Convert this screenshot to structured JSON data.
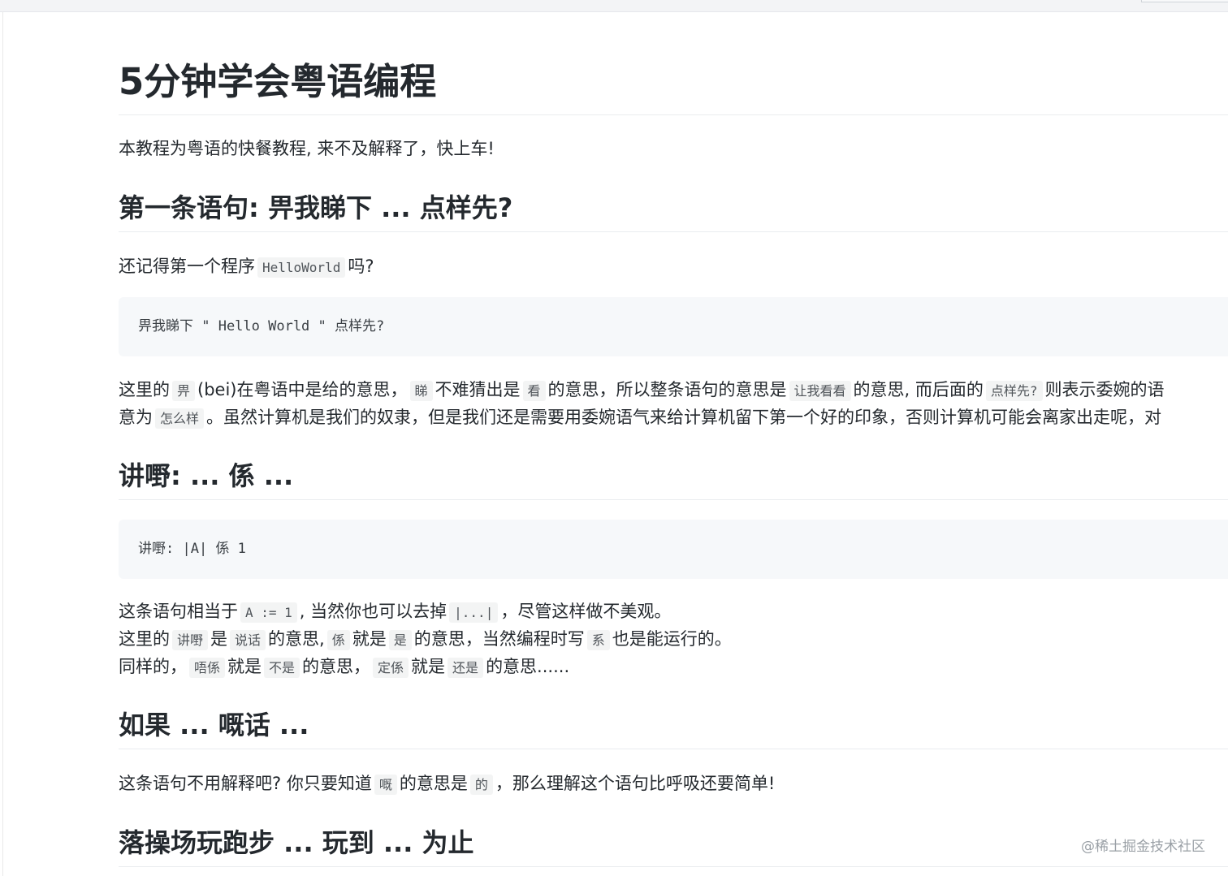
{
  "title": "5分钟学会粤语编程",
  "intro": "本教程为粤语的快餐教程, 来不及解释了，快上车!",
  "section1": {
    "heading": "第一条语句: 畀我睇下 ... 点样先?",
    "p1_a": "还记得第一个程序",
    "p1_code": "HelloWorld",
    "p1_b": "吗?",
    "codeblock": "畀我睇下 \" Hello World \" 点样先?",
    "p2_a": "这里的",
    "p2_c1": "畀",
    "p2_b": "(bei)在粤语中是给的意思，",
    "p2_c2": "睇",
    "p2_c": "不难猜出是",
    "p2_c3": "看",
    "p2_d": "的意思，所以整条语句的意思是",
    "p2_c4": "让我看看",
    "p2_e": "的意思, 而后面的",
    "p2_c5": "点样先?",
    "p2_f": "则表示委婉的语",
    "p3_a": "意为",
    "p3_c1": "怎么样",
    "p3_b": "。虽然计算机是我们的奴隶，但是我们还是需要用委婉语气来给计算机留下第一个好的印象，否则计算机可能会离家出走呢，对"
  },
  "section2": {
    "heading": "讲嘢: ... 係 ...",
    "codeblock": "讲嘢: |A| 係 1",
    "l1_a": "这条语句相当于",
    "l1_c1": "A := 1",
    "l1_b": ", 当然你也可以去掉",
    "l1_c2": "|...|",
    "l1_c": "，尽管这样做不美观。",
    "l2_a": "这里的",
    "l2_c1": "讲嘢",
    "l2_b": "是",
    "l2_c2": "说话",
    "l2_c": "的意思,",
    "l2_c3": "係",
    "l2_d": "就是",
    "l2_c4": "是",
    "l2_e": "的意思，当然编程时写",
    "l2_c5": "系",
    "l2_f": "也是能运行的。",
    "l3_a": "同样的，",
    "l3_c1": "唔係",
    "l3_b": "就是",
    "l3_c2": "不是",
    "l3_c": "的意思，",
    "l3_c3": "定係",
    "l3_d": "就是",
    "l3_c4": "还是",
    "l3_e": "的意思......"
  },
  "section3": {
    "heading": "如果 ... 嘅话 ...",
    "p_a": "这条语句不用解释吧? 你只要知道",
    "p_c1": "嘅",
    "p_b": "的意思是",
    "p_c2": "的",
    "p_c": "，那么理解这个语句比呼吸还要简单!"
  },
  "section4": {
    "heading": "落操场玩跑步 ... 玩到 ... 为止"
  },
  "watermark": "@稀土掘金技术社区"
}
